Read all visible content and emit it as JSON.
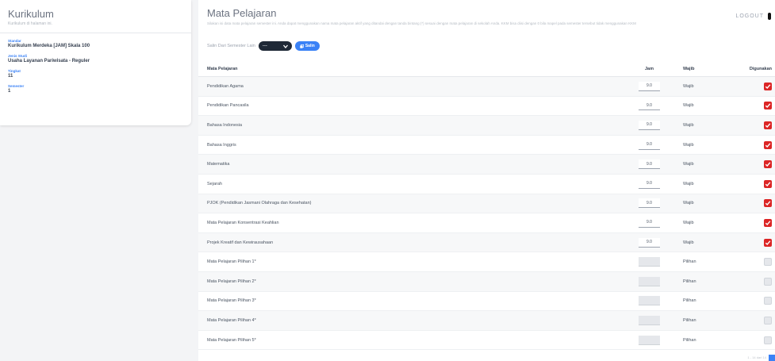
{
  "sidebar": {
    "title": "Kurikulum",
    "subtitle": "Kurikulum di halaman ini.",
    "fields": [
      {
        "label": "Standar",
        "value": "Kurikulum Merdeka [JAM] Skala 100"
      },
      {
        "label": "Jenis Studi",
        "value": "Usaha Layanan Pariwisata - Reguler"
      },
      {
        "label": "Tingkat",
        "value": "11"
      },
      {
        "label": "Semester",
        "value": "1"
      }
    ]
  },
  "header": {
    "title": "Mata Pelajaran",
    "description": "Silakan isi data mata pelajaran semester ini. Anda dapat menggunakan nama mata pelajaran aktif yang ditandai dengan tanda bintang (*) sesuai dengan mata pelajaran di sekolah Anda. KKM bisa diisi dengan 0 bila mapel pada semester tersebut tidak menggunakan KKM",
    "logout_label": "LOGOUT"
  },
  "copy": {
    "label": "Salin Dari Semester Lain",
    "select_value": "---",
    "button_label": "Salin"
  },
  "table": {
    "headers": {
      "name": "Mata Pelajaran",
      "jam": "Jam",
      "wajib": "Wajib",
      "used": "Digunakan"
    },
    "rows": [
      {
        "name": "Pendidikan Agama",
        "jam": "9.0",
        "wajib": "Wajib",
        "used": true
      },
      {
        "name": "Pendidikan Pancasila",
        "jam": "9.0",
        "wajib": "Wajib",
        "used": true
      },
      {
        "name": "Bahasa Indonesia",
        "jam": "9.0",
        "wajib": "Wajib",
        "used": true
      },
      {
        "name": "Bahasa Inggris",
        "jam": "9.0",
        "wajib": "Wajib",
        "used": true
      },
      {
        "name": "Matematika",
        "jam": "9.0",
        "wajib": "Wajib",
        "used": true
      },
      {
        "name": "Sejarah",
        "jam": "9.0",
        "wajib": "Wajib",
        "used": true
      },
      {
        "name": "PJOK (Pendidikan Jasmani Olahraga dan Kesehatan)",
        "jam": "9.0",
        "wajib": "Wajib",
        "used": true
      },
      {
        "name": "Mata Pelajaran Konsentrasi Keahlian",
        "jam": "9.0",
        "wajib": "Wajib",
        "used": true
      },
      {
        "name": "Projek Kreatif dan Kewirausahaan",
        "jam": "9.0",
        "wajib": "Wajib",
        "used": true
      },
      {
        "name": "Mata Pelajaran Pilihan 1*",
        "jam": "",
        "wajib": "Pilihan",
        "used": false
      },
      {
        "name": "Mata Pelajaran Pilihan 2*",
        "jam": "",
        "wajib": "Pilihan",
        "used": false
      },
      {
        "name": "Mata Pelajaran Pilihan 3*",
        "jam": "",
        "wajib": "Pilihan",
        "used": false
      },
      {
        "name": "Mata Pelajaran Pilihan 4*",
        "jam": "",
        "wajib": "Pilihan",
        "used": false
      },
      {
        "name": "Mata Pelajaran Pilihan 5*",
        "jam": "",
        "wajib": "Pilihan",
        "used": false
      }
    ]
  },
  "footer": {
    "pager_text": "1 - 14 dari 14"
  },
  "colors": {
    "accent": "#3b82f6",
    "checked": "#dc2626",
    "dark_pill": "#1f2937"
  }
}
